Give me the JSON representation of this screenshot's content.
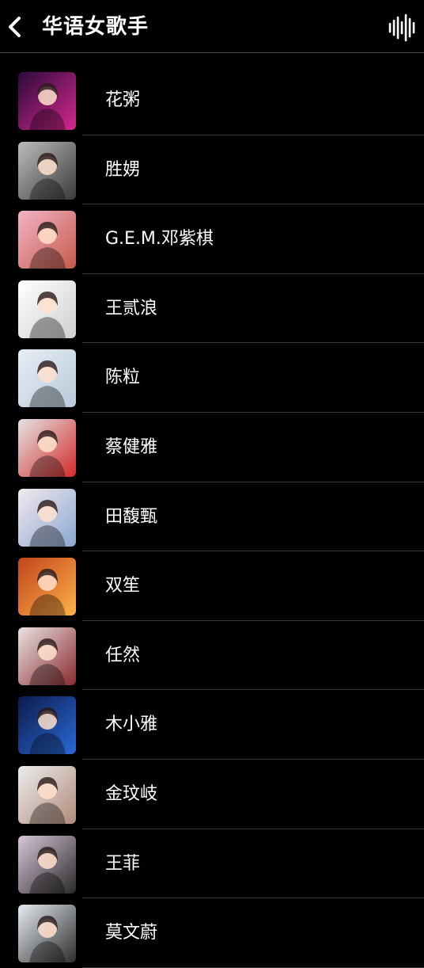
{
  "header": {
    "title": "华语女歌手",
    "back_icon": "chevron-left-icon",
    "now_playing_icon": "sound-wave-icon"
  },
  "colors": {
    "background": "#000000",
    "text": "#ffffff",
    "separator": "#3a3a3a"
  },
  "artists": [
    {
      "name": "花粥",
      "thumb": [
        "#2a0a3a",
        "#d6288f"
      ]
    },
    {
      "name": "胜娚",
      "thumb": [
        "#bdbdbd",
        "#3a3a3a"
      ]
    },
    {
      "name": "G.E.M.邓紫棋",
      "thumb": [
        "#f3b3c6",
        "#c55a4a"
      ]
    },
    {
      "name": "王贰浪",
      "thumb": [
        "#ffffff",
        "#cfcfcf"
      ]
    },
    {
      "name": "陈粒",
      "thumb": [
        "#e8eef6",
        "#b7c9d8"
      ]
    },
    {
      "name": "蔡健雅",
      "thumb": [
        "#e4e4e4",
        "#d42a2a"
      ]
    },
    {
      "name": "田馥甄",
      "thumb": [
        "#f2e9ee",
        "#8aa7d1"
      ]
    },
    {
      "name": "双笙",
      "thumb": [
        "#c2451a",
        "#ffb14a"
      ]
    },
    {
      "name": "任然",
      "thumb": [
        "#e9e2e2",
        "#8a2a2f"
      ]
    },
    {
      "name": "木小雅",
      "thumb": [
        "#0b1a4a",
        "#2a6ad8"
      ]
    },
    {
      "name": "金玟岐",
      "thumb": [
        "#ececec",
        "#b08a7a"
      ]
    },
    {
      "name": "王菲",
      "thumb": [
        "#d8c6d9",
        "#2a2a2a"
      ]
    },
    {
      "name": "莫文蔚",
      "thumb": [
        "#e6ecf2",
        "#2c2c2c"
      ]
    }
  ]
}
